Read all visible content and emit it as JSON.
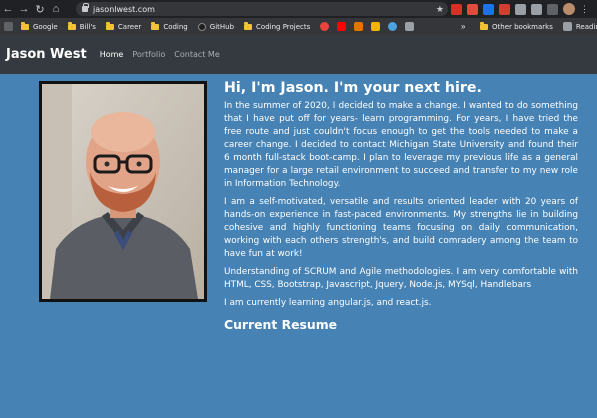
{
  "browser": {
    "url": "jasonlwest.com",
    "nav": {
      "back": "←",
      "forward": "→",
      "reload": "↻",
      "home": "⌂"
    },
    "star_icon": "★",
    "menu_icon": "⋮",
    "extensions": [
      {
        "name": "ext-red-icon",
        "color": "#d93025"
      },
      {
        "name": "ext-shortcut-icon",
        "color": "#e04b3b"
      },
      {
        "name": "ext-blue-icon",
        "color": "#1a73e8"
      },
      {
        "name": "ext-video-icon",
        "color": "#d23f31"
      },
      {
        "name": "ext-camera-icon",
        "color": "#9aa0a6"
      },
      {
        "name": "ext-puzzle-icon",
        "color": "#9aa0a6"
      }
    ]
  },
  "bookmarks": {
    "items": [
      "Google",
      "Bill's",
      "Career",
      "Coding",
      "GitHub",
      "Coding Projects"
    ],
    "overflow": "»",
    "other": "Other bookmarks",
    "reading": "Readin"
  },
  "site": {
    "brand": "Jason West",
    "nav": [
      "Home",
      "Portfolio",
      "Contact Me"
    ]
  },
  "content": {
    "headline": "Hi, I'm Jason. I'm your next hire.",
    "paragraphs": [
      "In the summer of 2020, I decided to make a change. I wanted to do something that I have put off for years- learn programming. For years, I have tried the free route and just couldn't focus enough to get the tools needed to make a career change. I decided to contact Michigan State University and found their 6 month full-stack boot-camp. I plan to leverage my previous life as a general manager for a large retail environment to succeed and transfer to my new role in Information Technology.",
      "I am a self-motivated, versatile and results oriented leader with 20 years of hands-on experience in fast-paced environments. My strengths lie in building cohesive and highly functioning teams focusing on daily communication, working with each others strength's, and build comradery among the team to have fun at work!",
      "Understanding of SCRUM and Agile methodologies. I am very comfortable with HTML, CSS, Bootstrap, Javascript, Jquery, Node.js, MYSql, Handlebars",
      "I am currently learning angular.js, and react.js."
    ],
    "resume_title": "Current Resume"
  },
  "colors": {
    "page_background": "#4682b4",
    "navbar": "#343a40",
    "text": "#ffffff"
  }
}
